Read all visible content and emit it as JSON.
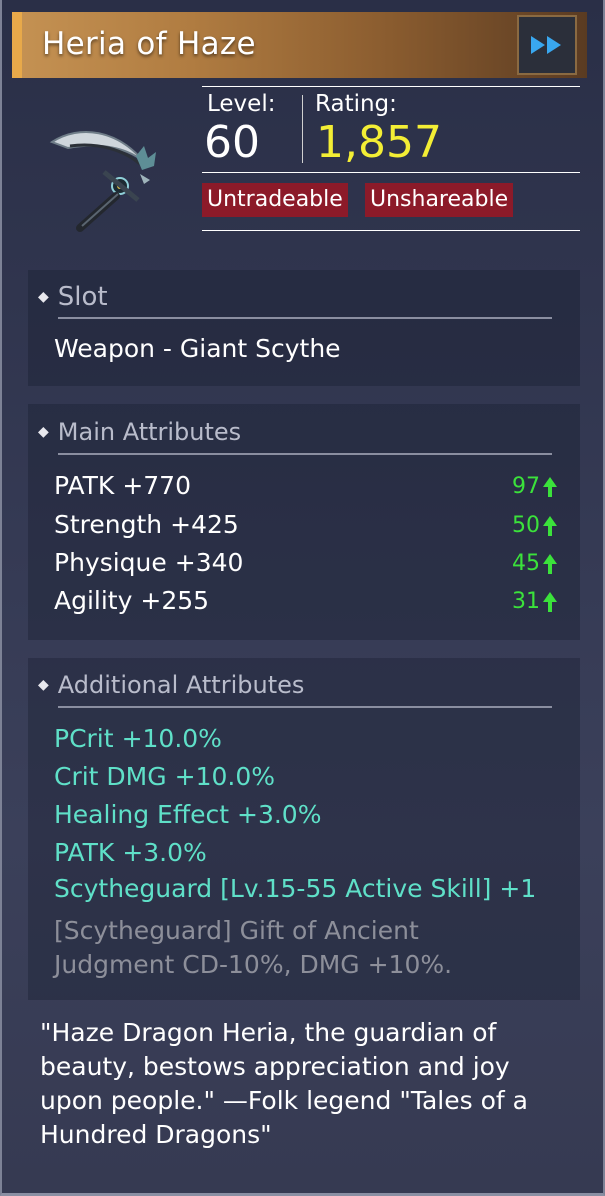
{
  "header": {
    "title": "Heria of Haze",
    "forward_button": "fast-forward-icon"
  },
  "item": {
    "icon": "giant-scythe-icon"
  },
  "stats": {
    "level_label": "Level:",
    "level_value": "60",
    "rating_label": "Rating:",
    "rating_value": "1,857",
    "rating_color": "#f3ee35"
  },
  "badges": [
    "Untradeable",
    "Unshareable"
  ],
  "slot": {
    "heading": "Slot",
    "value": "Weapon - Giant Scythe"
  },
  "main_attributes": {
    "heading": "Main Attributes",
    "items": [
      {
        "name": "PATK",
        "value": "+770",
        "score": "97"
      },
      {
        "name": "Strength",
        "value": "+425",
        "score": "50"
      },
      {
        "name": "Physique",
        "value": "+340",
        "score": "45"
      },
      {
        "name": "Agility",
        "value": "+255",
        "score": "31"
      }
    ]
  },
  "additional_attributes": {
    "heading": "Additional Attributes",
    "items": [
      {
        "name": "PCrit",
        "value": "+10.0%"
      },
      {
        "name": "Crit DMG",
        "value": "+10.0%"
      },
      {
        "name": "Healing Effect",
        "value": "+3.0%"
      },
      {
        "name": "PATK",
        "value": "+3.0%"
      },
      {
        "name": "Scytheguard [Lv.15-55 Active Skill]",
        "value": "+1"
      }
    ],
    "inactive_note_line1": "[Scytheguard] Gift of Ancient",
    "inactive_note_line2": "Judgment CD-10%, DMG +10%."
  },
  "flavor_text": "\"Haze Dragon Heria, the guardian of beauty, bestows appreciation and joy upon people.\" —Folk legend \"Tales of a Hundred Dragons\"",
  "colors": {
    "header_accent": "#e8a94a",
    "badge_bg": "#8c1a29",
    "additional_text": "#5fe0c8",
    "score_up": "#3be23b"
  }
}
